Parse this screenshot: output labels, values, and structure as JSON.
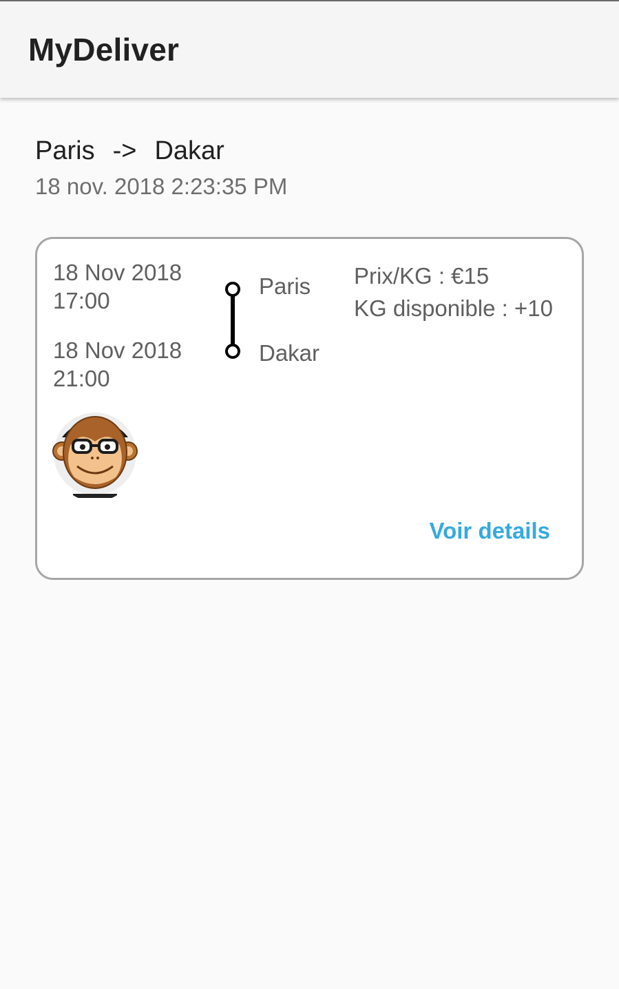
{
  "app": {
    "title": "MyDeliver"
  },
  "route": {
    "from": "Paris",
    "arrow": "->",
    "to": "Dakar",
    "date": "18 nov. 2018 2:23:35 PM"
  },
  "trip": {
    "departure_date": "18 Nov 2018",
    "departure_time": "17:00",
    "arrival_date": "18 Nov 2018",
    "arrival_time": "21:00",
    "from_city": "Paris",
    "to_city": "Dakar",
    "price_label": "Prix/KG : €15",
    "kg_label": "KG disponible : +10",
    "avatar_icon": "monkey-avatar-icon",
    "details_label": "Voir details"
  },
  "colors": {
    "link": "#35aadd",
    "card_border": "#a6a6a6",
    "title_text": "#212121",
    "secondary_text": "#5f5f5f"
  }
}
